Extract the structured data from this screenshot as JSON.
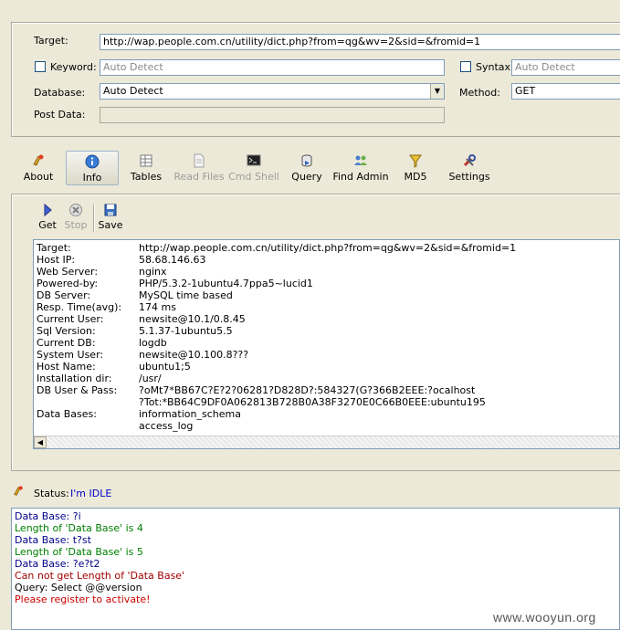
{
  "form": {
    "target_label": "Target:",
    "target_value": "http://wap.people.com.cn/utility/dict.php?from=qg&wv=2&sid=&fromid=1",
    "keyword_label": "Keyword:",
    "keyword_placeholder": "Auto Detect",
    "syntax_label": "Syntax:",
    "syntax_placeholder": "Auto Detect",
    "database_label": "Database:",
    "database_value": "Auto Detect",
    "method_label": "Method:",
    "method_value": "GET",
    "postdata_label": "Post Data:"
  },
  "toolbar": [
    {
      "label": "About",
      "icon": "about-icon"
    },
    {
      "label": "Info",
      "icon": "info-icon"
    },
    {
      "label": "Tables",
      "icon": "tables-icon"
    },
    {
      "label": "Read Files",
      "icon": "read-files-icon"
    },
    {
      "label": "Cmd Shell",
      "icon": "cmd-shell-icon"
    },
    {
      "label": "Query",
      "icon": "query-icon"
    },
    {
      "label": "Find Admin",
      "icon": "find-admin-icon"
    },
    {
      "label": "MD5",
      "icon": "md5-icon"
    },
    {
      "label": "Settings",
      "icon": "settings-icon"
    }
  ],
  "subtoolbar": {
    "get_label": "Get",
    "stop_label": "Stop",
    "save_label": "Save"
  },
  "info": {
    "rows": [
      {
        "key": "Target:",
        "value": "http://wap.people.com.cn/utility/dict.php?from=qg&wv=2&sid=&fromid=1"
      },
      {
        "key": "Host IP:",
        "value": "58.68.146.63"
      },
      {
        "key": "Web Server:",
        "value": "nginx"
      },
      {
        "key": "Powered-by:",
        "value": "PHP/5.3.2-1ubuntu4.7ppa5~lucid1"
      },
      {
        "key": "DB Server:",
        "value": "MySQL time based"
      },
      {
        "key": "Resp. Time(avg):",
        "value": "174 ms"
      },
      {
        "key": "Current User:",
        "value": "newsite@10.1/0.8.45"
      },
      {
        "key": "Sql Version:",
        "value": "5.1.37-1ubuntu5.5"
      },
      {
        "key": "Current DB:",
        "value": "logdb"
      },
      {
        "key": "System User:",
        "value": "newsite@10.100.8???"
      },
      {
        "key": "Host Name:",
        "value": "ubuntu1;5"
      },
      {
        "key": "Installation dir:",
        "value": "/usr/"
      },
      {
        "key": "DB User & Pass:",
        "value": "?oMt7*BB67C?E?2?06281?D828D?:584327(G?366B2EEE:?ocalhost"
      },
      {
        "key": "",
        "value": "?Tot:*BB64C9DF0A062813B728B0A38F3270E0C66B0EEE:ubuntu195"
      },
      {
        "key": "Data Bases:",
        "value": "information_schema"
      },
      {
        "key": "",
        "value": "access_log"
      }
    ]
  },
  "status": {
    "label": "Status:",
    "value": "I'm IDLE",
    "value_color": "#0000cc"
  },
  "log": {
    "lines": [
      {
        "text": "Data Base: ?i",
        "color": "#00008b"
      },
      {
        "text": "Length of 'Data Base' is 4",
        "color": "#008000"
      },
      {
        "text": "Data Base: t?st",
        "color": "#00008b"
      },
      {
        "text": "Length of 'Data Base' is 5",
        "color": "#008000"
      },
      {
        "text": "Data Base: ?e?t2",
        "color": "#00008b"
      },
      {
        "text": "Can not get Length of 'Data Base'",
        "color": "#a00000"
      },
      {
        "text": "Query: Select @@version",
        "color": "#000000"
      },
      {
        "text": "Please register to activate!",
        "color": "#cc0000"
      }
    ]
  },
  "watermark": "www.wooyun.org"
}
